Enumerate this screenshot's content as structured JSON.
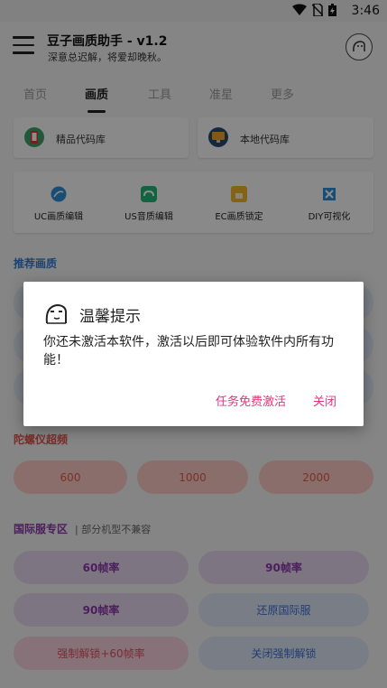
{
  "status_bar": {
    "time": "3:46",
    "icons": [
      "wifi-icon",
      "no-sim-icon",
      "battery-icon"
    ]
  },
  "header": {
    "title": "豆子画质助手 - v1.2",
    "subtitle": "深意总迟解，将爱却晚秋。"
  },
  "tabs": [
    {
      "label": "首页",
      "active": false
    },
    {
      "label": "画质",
      "active": true
    },
    {
      "label": "工具",
      "active": false
    },
    {
      "label": "准星",
      "active": false
    },
    {
      "label": "更多",
      "active": false
    }
  ],
  "libraries": [
    {
      "label": "精品代码库",
      "icon": "phone-icon"
    },
    {
      "label": "本地代码库",
      "icon": "computer-icon"
    }
  ],
  "tools": [
    {
      "label": "UC画质编辑",
      "icon": "globe-icon"
    },
    {
      "label": "US音质编辑",
      "icon": "gamepad-icon"
    },
    {
      "label": "EC画质锁定",
      "icon": "lock-icon"
    },
    {
      "label": "DIY可视化",
      "icon": "puzzle-icon"
    }
  ],
  "sections": {
    "recommended": "推荐画质",
    "gyro": "陀螺仪超频",
    "intl": "国际服专区",
    "intl_note": "部分机型不兼容"
  },
  "gyro_buttons": [
    "600",
    "1000",
    "2000"
  ],
  "intl_buttons": [
    [
      "60帧率",
      "90帧率"
    ],
    [
      "90帧率",
      "还原国际服"
    ],
    [
      "强制解锁+60帧率",
      "关闭强制解锁"
    ]
  ],
  "dialog": {
    "title": "温馨提示",
    "message": "你还未激活本软件，激活以后即可体验软件内所有功能！",
    "primary_button": "任务免费激活",
    "close_button": "关闭"
  },
  "colors": {
    "accent": "#2e7bd6",
    "dialog_button": "#e0347c",
    "gyro_pill": "#f9c9c4",
    "intl_pill": "#e6d6ee"
  }
}
